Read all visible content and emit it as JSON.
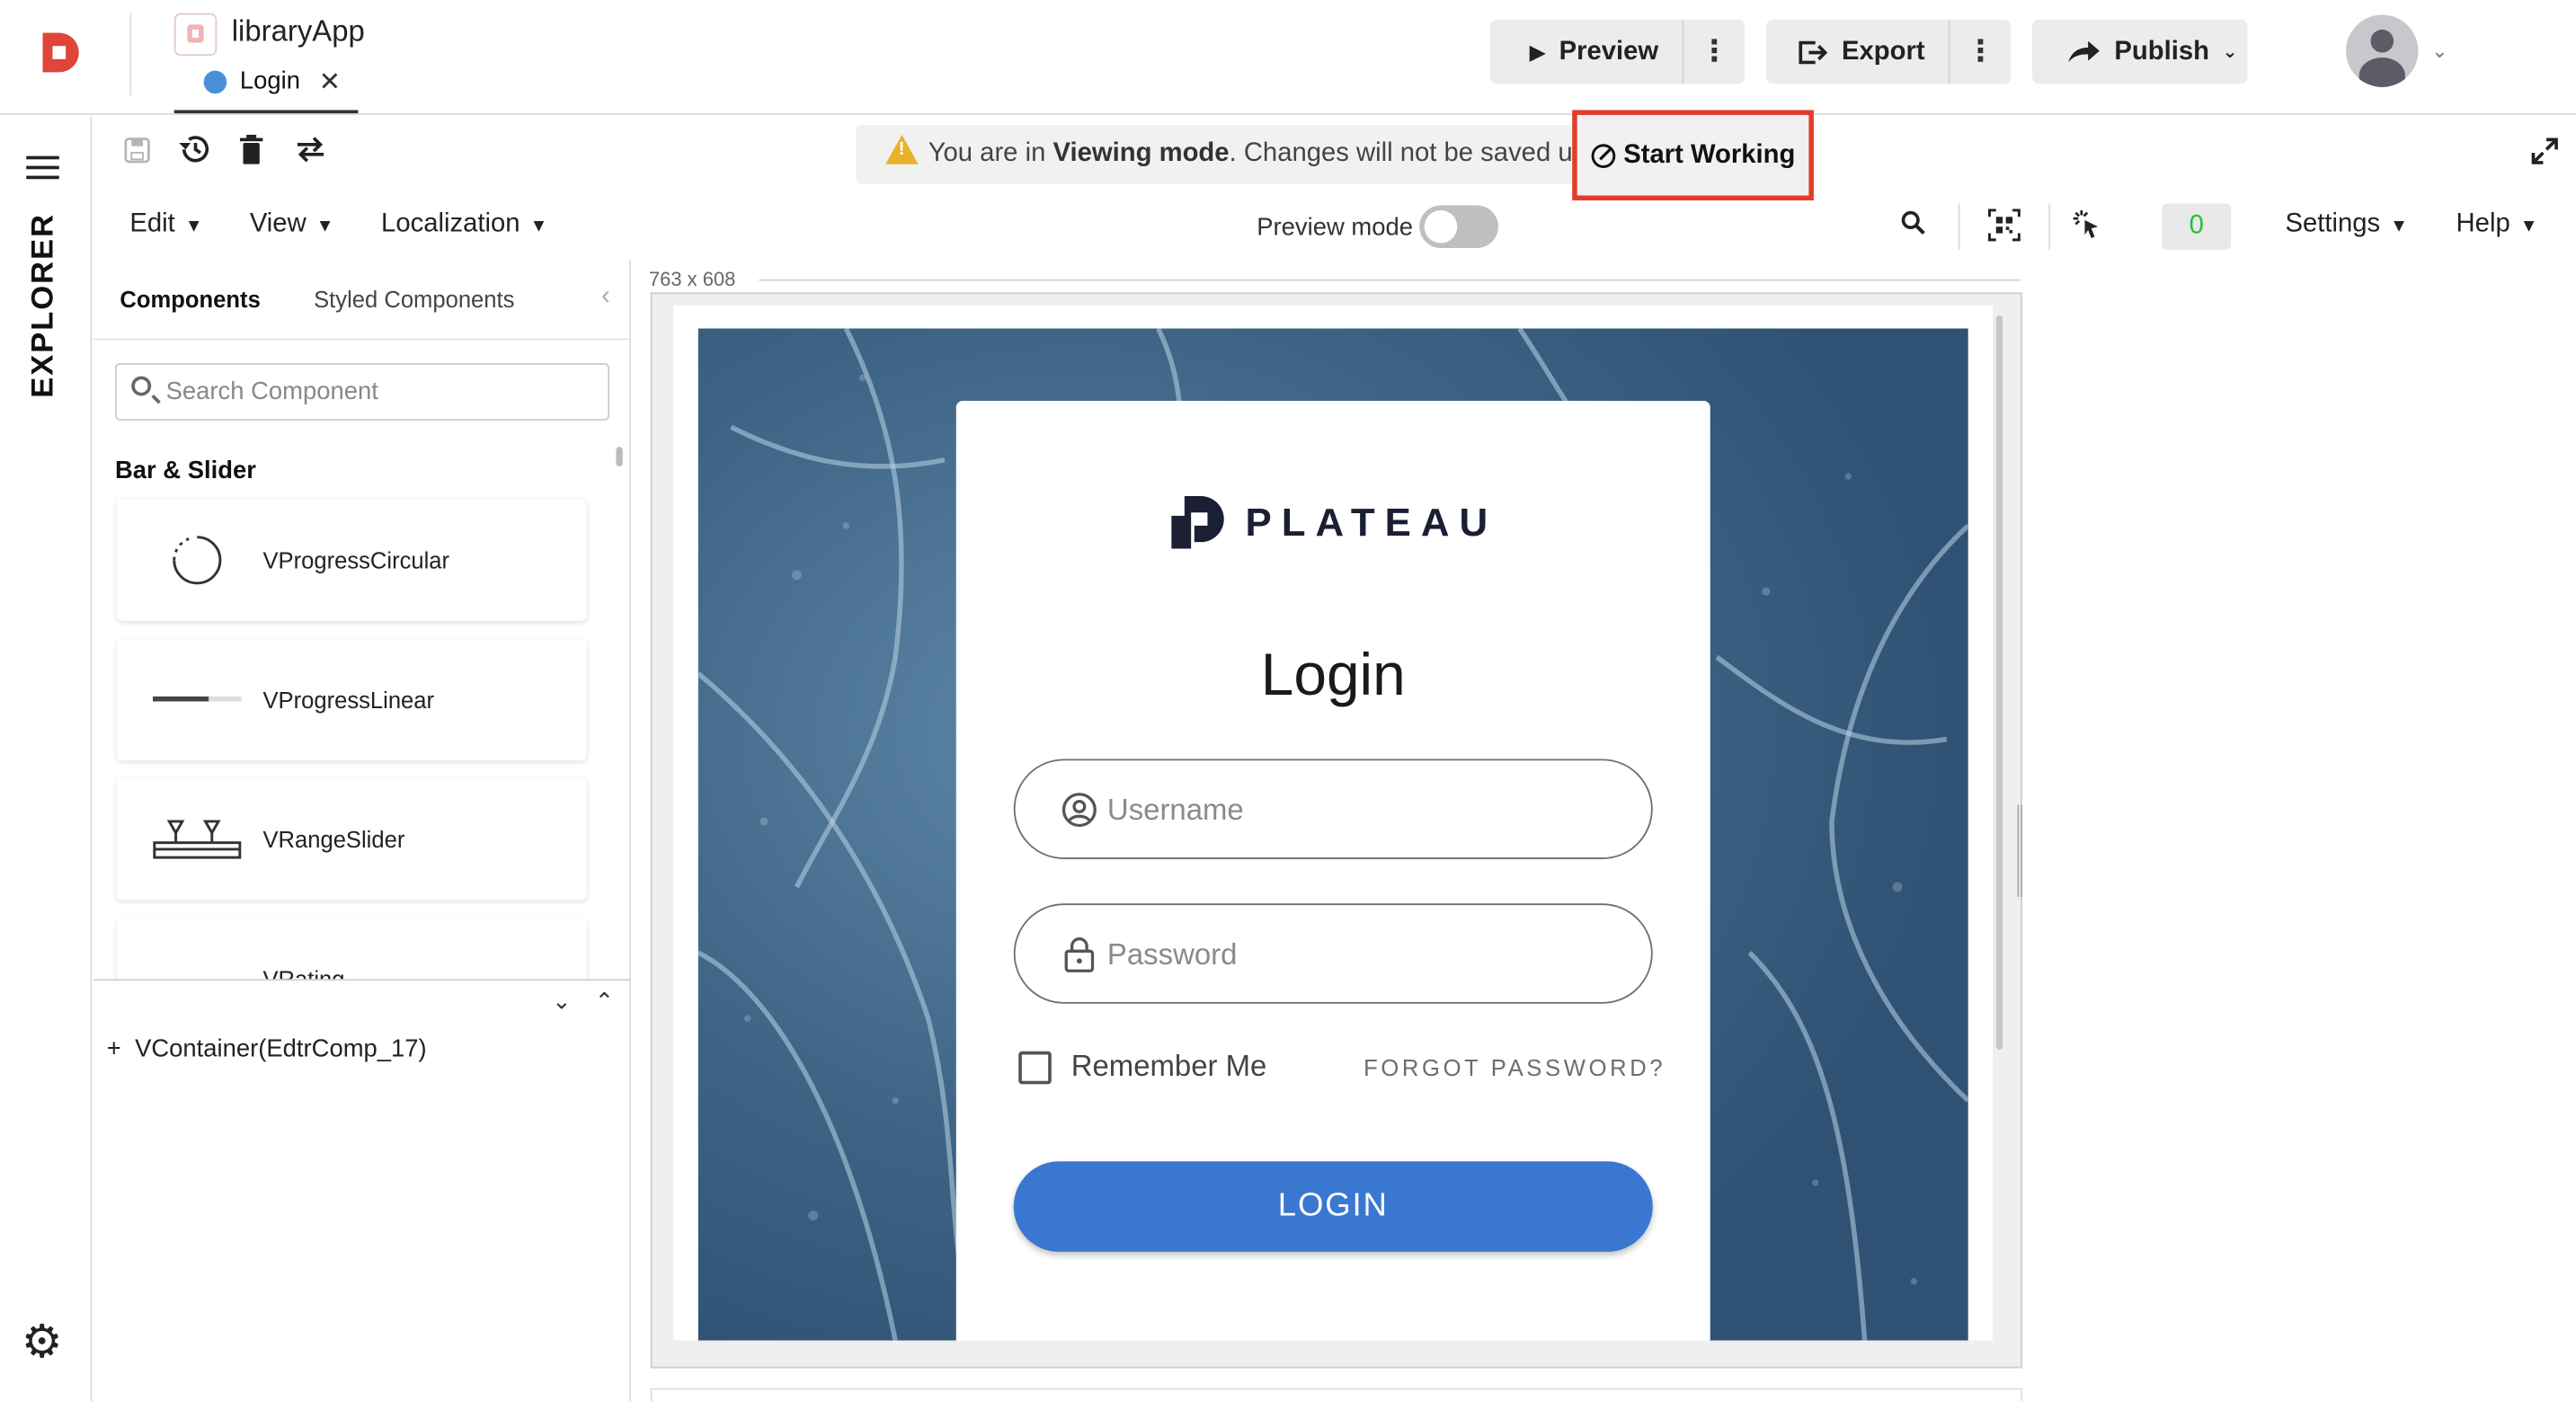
{
  "header": {
    "app_title": "libraryApp",
    "tab_label": "Login",
    "tab_close": "✕",
    "preview_label": "Preview",
    "export_label": "Export",
    "publish_label": "Publish",
    "more_glyph": "⋮"
  },
  "sidebar": {
    "explorer_label": "EXPLORER"
  },
  "banner": {
    "prefix": "You are in ",
    "mode": "Viewing mode",
    "suffix": ". Changes will not be saved until",
    "start_working": "Start Working"
  },
  "menu": {
    "edit": "Edit",
    "view": "View",
    "localization": "Localization",
    "preview_mode": "Preview mode",
    "preview_mode_on": false,
    "counter": "0",
    "settings": "Settings",
    "help": "Help"
  },
  "explorer": {
    "tab_components": "Components",
    "tab_styled": "Styled Components",
    "search_placeholder": "Search Component",
    "group": "Bar & Slider",
    "items": [
      {
        "label": "VProgressCircular",
        "icon": "progress-circular-icon"
      },
      {
        "label": "VProgressLinear",
        "icon": "progress-linear-icon"
      },
      {
        "label": "VRangeSlider",
        "icon": "range-slider-icon"
      },
      {
        "label": "VRating",
        "icon": "rating-icon"
      }
    ],
    "tree_root": "VContainer(EdtrComp_17)"
  },
  "canvas": {
    "size_label": "763 x 608",
    "brand": "PLATEAU",
    "title": "Login",
    "username_placeholder": "Username",
    "password_placeholder": "Password",
    "remember_label": "Remember Me",
    "forgot_label": "FORGOT PASSWORD?",
    "login_button": "LOGIN"
  },
  "colors": {
    "accent": "#3a77d1",
    "highlight": "#e23d2a",
    "brand_red": "#e0453a",
    "counter_green": "#2dbe3a",
    "warning": "#e7b32a"
  }
}
